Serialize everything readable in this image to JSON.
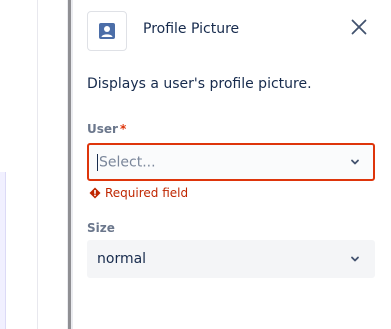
{
  "panel": {
    "title": "Profile Picture",
    "description": "Displays a user's profile picture."
  },
  "fields": {
    "user": {
      "label": "User",
      "required_mark": "*",
      "placeholder": "Select...",
      "error": "Required field"
    },
    "size": {
      "label": "Size",
      "value": "normal"
    }
  },
  "icons": {
    "header": "profile-picture-icon",
    "close": "close-icon",
    "dropdown": "chevron-down-icon",
    "error": "error-icon"
  },
  "colors": {
    "error": "#de350b",
    "text": "#172b4d",
    "muted": "#6b778c",
    "accent": "#4c6ea8"
  }
}
